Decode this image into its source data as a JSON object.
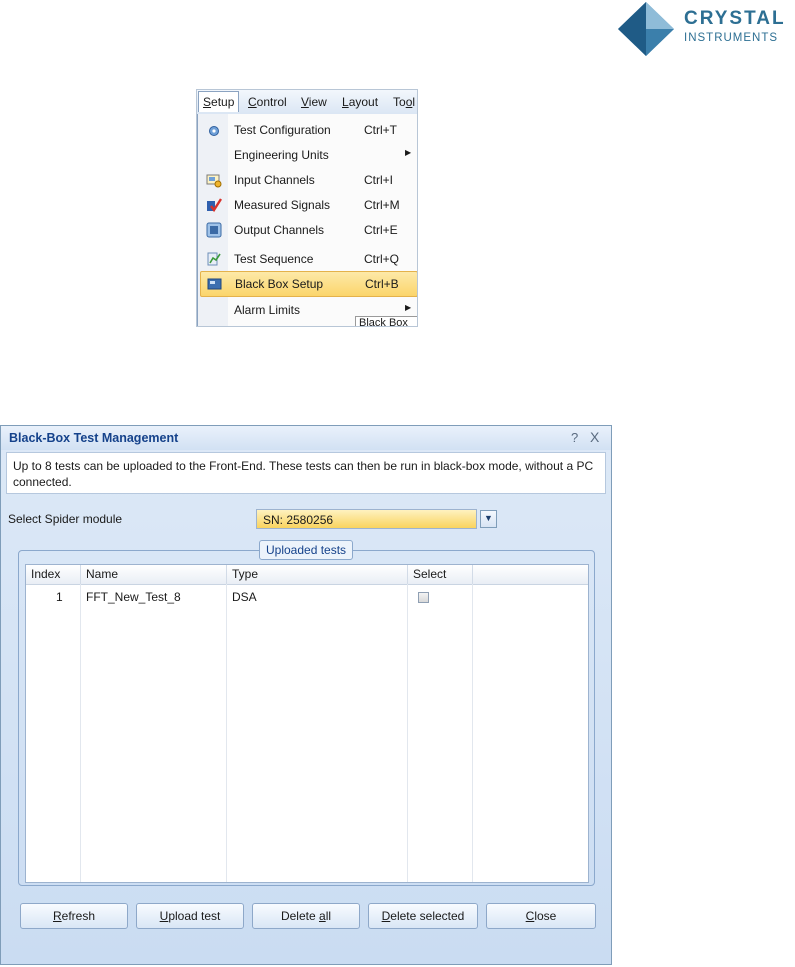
{
  "logo": {
    "line1": "CRYSTAL",
    "line2": "INSTRUMENTS",
    "colors": {
      "dark": "#1f5b86",
      "light": "#5b9cc4"
    }
  },
  "menu": {
    "bar_items": [
      {
        "pre": "",
        "key": "S",
        "post": "etup"
      },
      {
        "pre": "",
        "key": "C",
        "post": "ontrol"
      },
      {
        "pre": "",
        "key": "V",
        "post": "iew"
      },
      {
        "pre": "",
        "key": "L",
        "post": "ayout"
      },
      {
        "pre": "To",
        "key": "o",
        "post": "l"
      }
    ],
    "items": [
      {
        "label": "Test Configuration",
        "shortcut": "Ctrl+T",
        "icon": "test-configuration-icon"
      },
      {
        "label": "Engineering Units",
        "shortcut": "",
        "submenu": true
      },
      {
        "label": "Input Channels",
        "shortcut": "Ctrl+I",
        "icon": "input-channels-icon"
      },
      {
        "label": "Measured Signals",
        "shortcut": "Ctrl+M",
        "icon": "measured-signals-icon"
      },
      {
        "label": "Output Channels",
        "shortcut": "Ctrl+E",
        "icon": "output-channels-icon"
      },
      {
        "label": "Test Sequence",
        "shortcut": "Ctrl+Q",
        "icon": "test-sequence-icon"
      },
      {
        "label": "Black Box Setup",
        "shortcut": "Ctrl+B",
        "icon": "black-box-setup-icon",
        "highlighted": true
      },
      {
        "label": "Alarm Limits",
        "shortcut": "",
        "submenu": true
      }
    ],
    "tooltip": "Black Box"
  },
  "dialog": {
    "title": "Black-Box Test Management",
    "help_glyph": "?",
    "close_glyph": "X",
    "description": "Up to 8 tests can be uploaded to the Front-End. These tests can then be run in black-box mode, without a PC connected.",
    "spider_label": "Select Spider module",
    "spider_value": "SN: 2580256",
    "group_title": "Uploaded tests",
    "columns": [
      "Index",
      "Name",
      "Type",
      "Select"
    ],
    "rows": [
      {
        "index": "1",
        "name": "FFT_New_Test_8",
        "type": "DSA",
        "selected": false
      }
    ],
    "buttons": [
      {
        "pre": "",
        "key": "R",
        "post": "efresh"
      },
      {
        "pre": "",
        "key": "U",
        "post": "pload test"
      },
      {
        "pre": "Delete ",
        "key": "a",
        "post": "ll"
      },
      {
        "pre": "",
        "key": "D",
        "post": "elete selected"
      },
      {
        "pre": "",
        "key": "C",
        "post": "lose"
      }
    ],
    "accent_color": "#f9d35e"
  }
}
